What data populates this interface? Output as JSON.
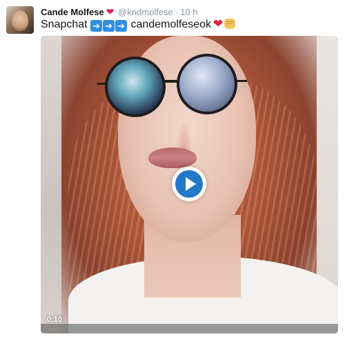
{
  "tweet": {
    "author_name": "Cande Molfese",
    "author_heart": "❤",
    "handle": "@kndmolfese",
    "separator": "·",
    "time": "10 h",
    "text_word": "Snapchat",
    "text_username": "candemolfeseok",
    "arrow_glyph": "➔",
    "text_heart": "❤"
  },
  "video": {
    "duration": "0:10"
  },
  "colors": {
    "accent": "#2477c9",
    "heart": "#e0245e",
    "muted": "#8899a6"
  },
  "icons": {
    "avatar": "avatar",
    "play": "play-icon",
    "arrow": "right-arrow-emoji",
    "fist": "fist-bump-emoji"
  }
}
